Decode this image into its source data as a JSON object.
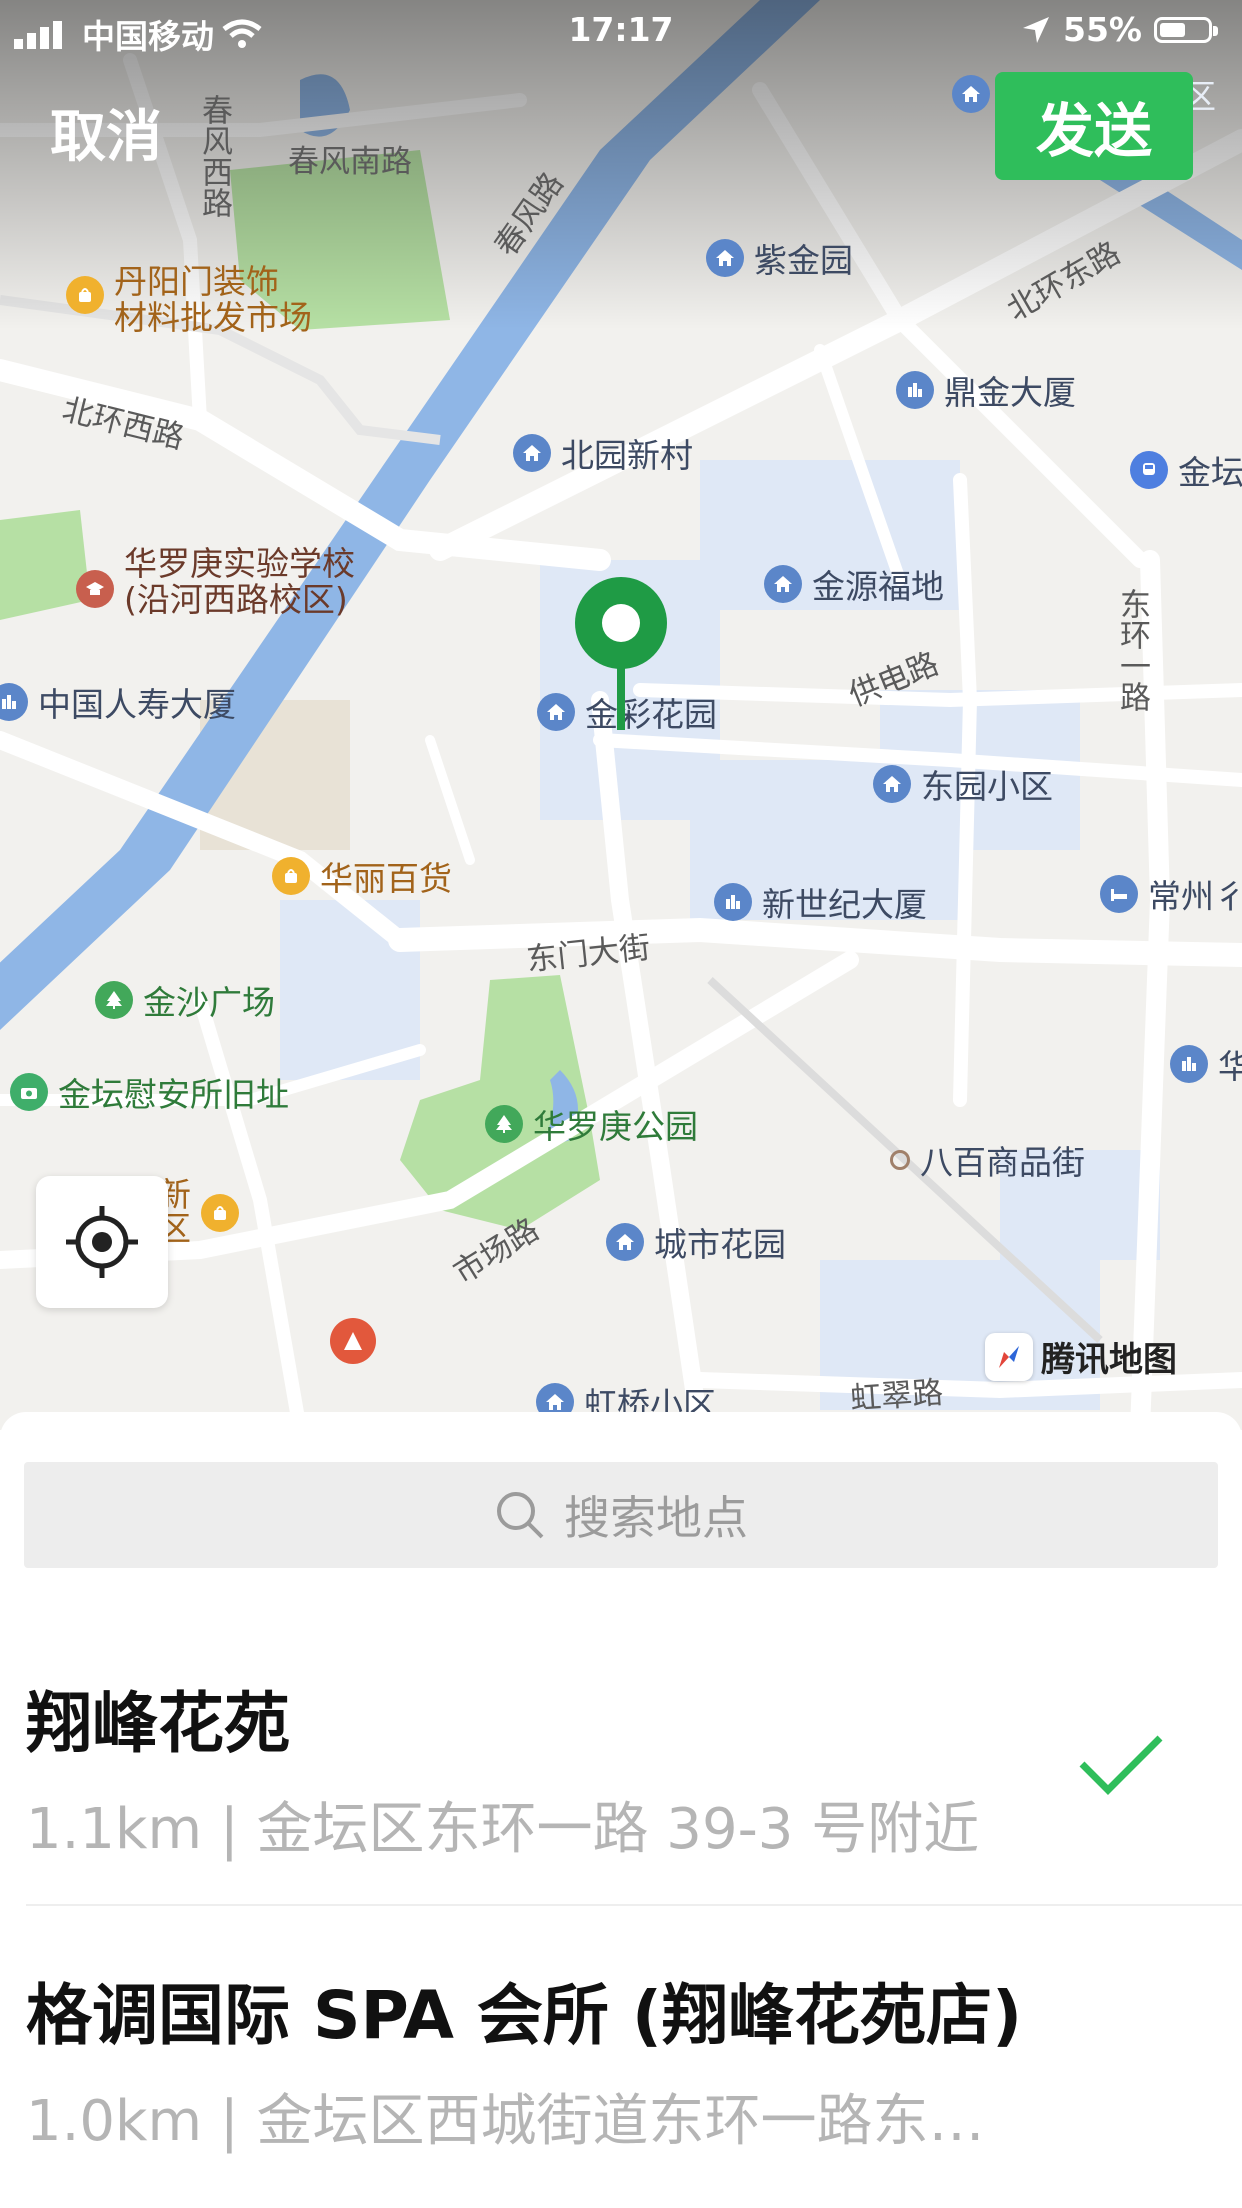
{
  "status_bar": {
    "carrier": "中国移动",
    "time": "17:17",
    "battery": "55%",
    "battery_level": 0.55
  },
  "header": {
    "cancel_label": "取消",
    "send_label": "发送"
  },
  "map": {
    "pois": [
      {
        "name": "紫金园",
        "icon": "home"
      },
      {
        "name": "鼎金大厦",
        "icon": "building"
      },
      {
        "name": "北园新村",
        "icon": "home"
      },
      {
        "name": "金坛",
        "icon": "subway"
      },
      {
        "name": "丹阳门装饰\n材料批发市场",
        "icon": "shop"
      },
      {
        "name": "华罗庚实验学校\n(沿河西路校区)",
        "icon": "school"
      },
      {
        "name": "金源福地",
        "icon": "home"
      },
      {
        "name": "中国人寿大厦",
        "icon": "building"
      },
      {
        "name": "金彩花园",
        "icon": "home"
      },
      {
        "name": "东园小区",
        "icon": "home"
      },
      {
        "name": "华丽百货",
        "icon": "shop"
      },
      {
        "name": "新世纪大厦",
        "icon": "building"
      },
      {
        "name": "常州彳",
        "icon": "hotel"
      },
      {
        "name": "金沙广场",
        "icon": "park"
      },
      {
        "name": "金坛慰安所旧址",
        "icon": "camera"
      },
      {
        "name": "华罗庚公园",
        "icon": "park"
      },
      {
        "name": "八百商品街",
        "icon": "dot"
      },
      {
        "name": "城市花园",
        "icon": "home"
      },
      {
        "name": "新\n区",
        "icon": "shop"
      },
      {
        "name": "虹桥小区",
        "icon": "home"
      },
      {
        "name": "华",
        "icon": "building"
      },
      {
        "name": "东区",
        "icon": "home"
      }
    ],
    "roads": [
      "春风南路",
      "春风西路",
      "春风路",
      "北环东路",
      "北环西路",
      "供电路",
      "东环一路",
      "东门大街",
      "市场路",
      "虹翠路"
    ],
    "brand": "腾讯地图"
  },
  "search": {
    "placeholder": "搜索地点"
  },
  "results": [
    {
      "title": "翔峰花苑",
      "subtitle": "1.1km | 金坛区东环一路 39-3 号附近",
      "selected": true
    },
    {
      "title": "格调国际 SPA 会所 (翔峰花苑店)",
      "subtitle": "1.0km | 金坛区西城街道东环一路东…",
      "selected": false
    }
  ],
  "colors": {
    "accent": "#2fbe5b",
    "water": "#8fb6e6",
    "park": "#b6e0a4",
    "pin": "#1f9b45"
  }
}
